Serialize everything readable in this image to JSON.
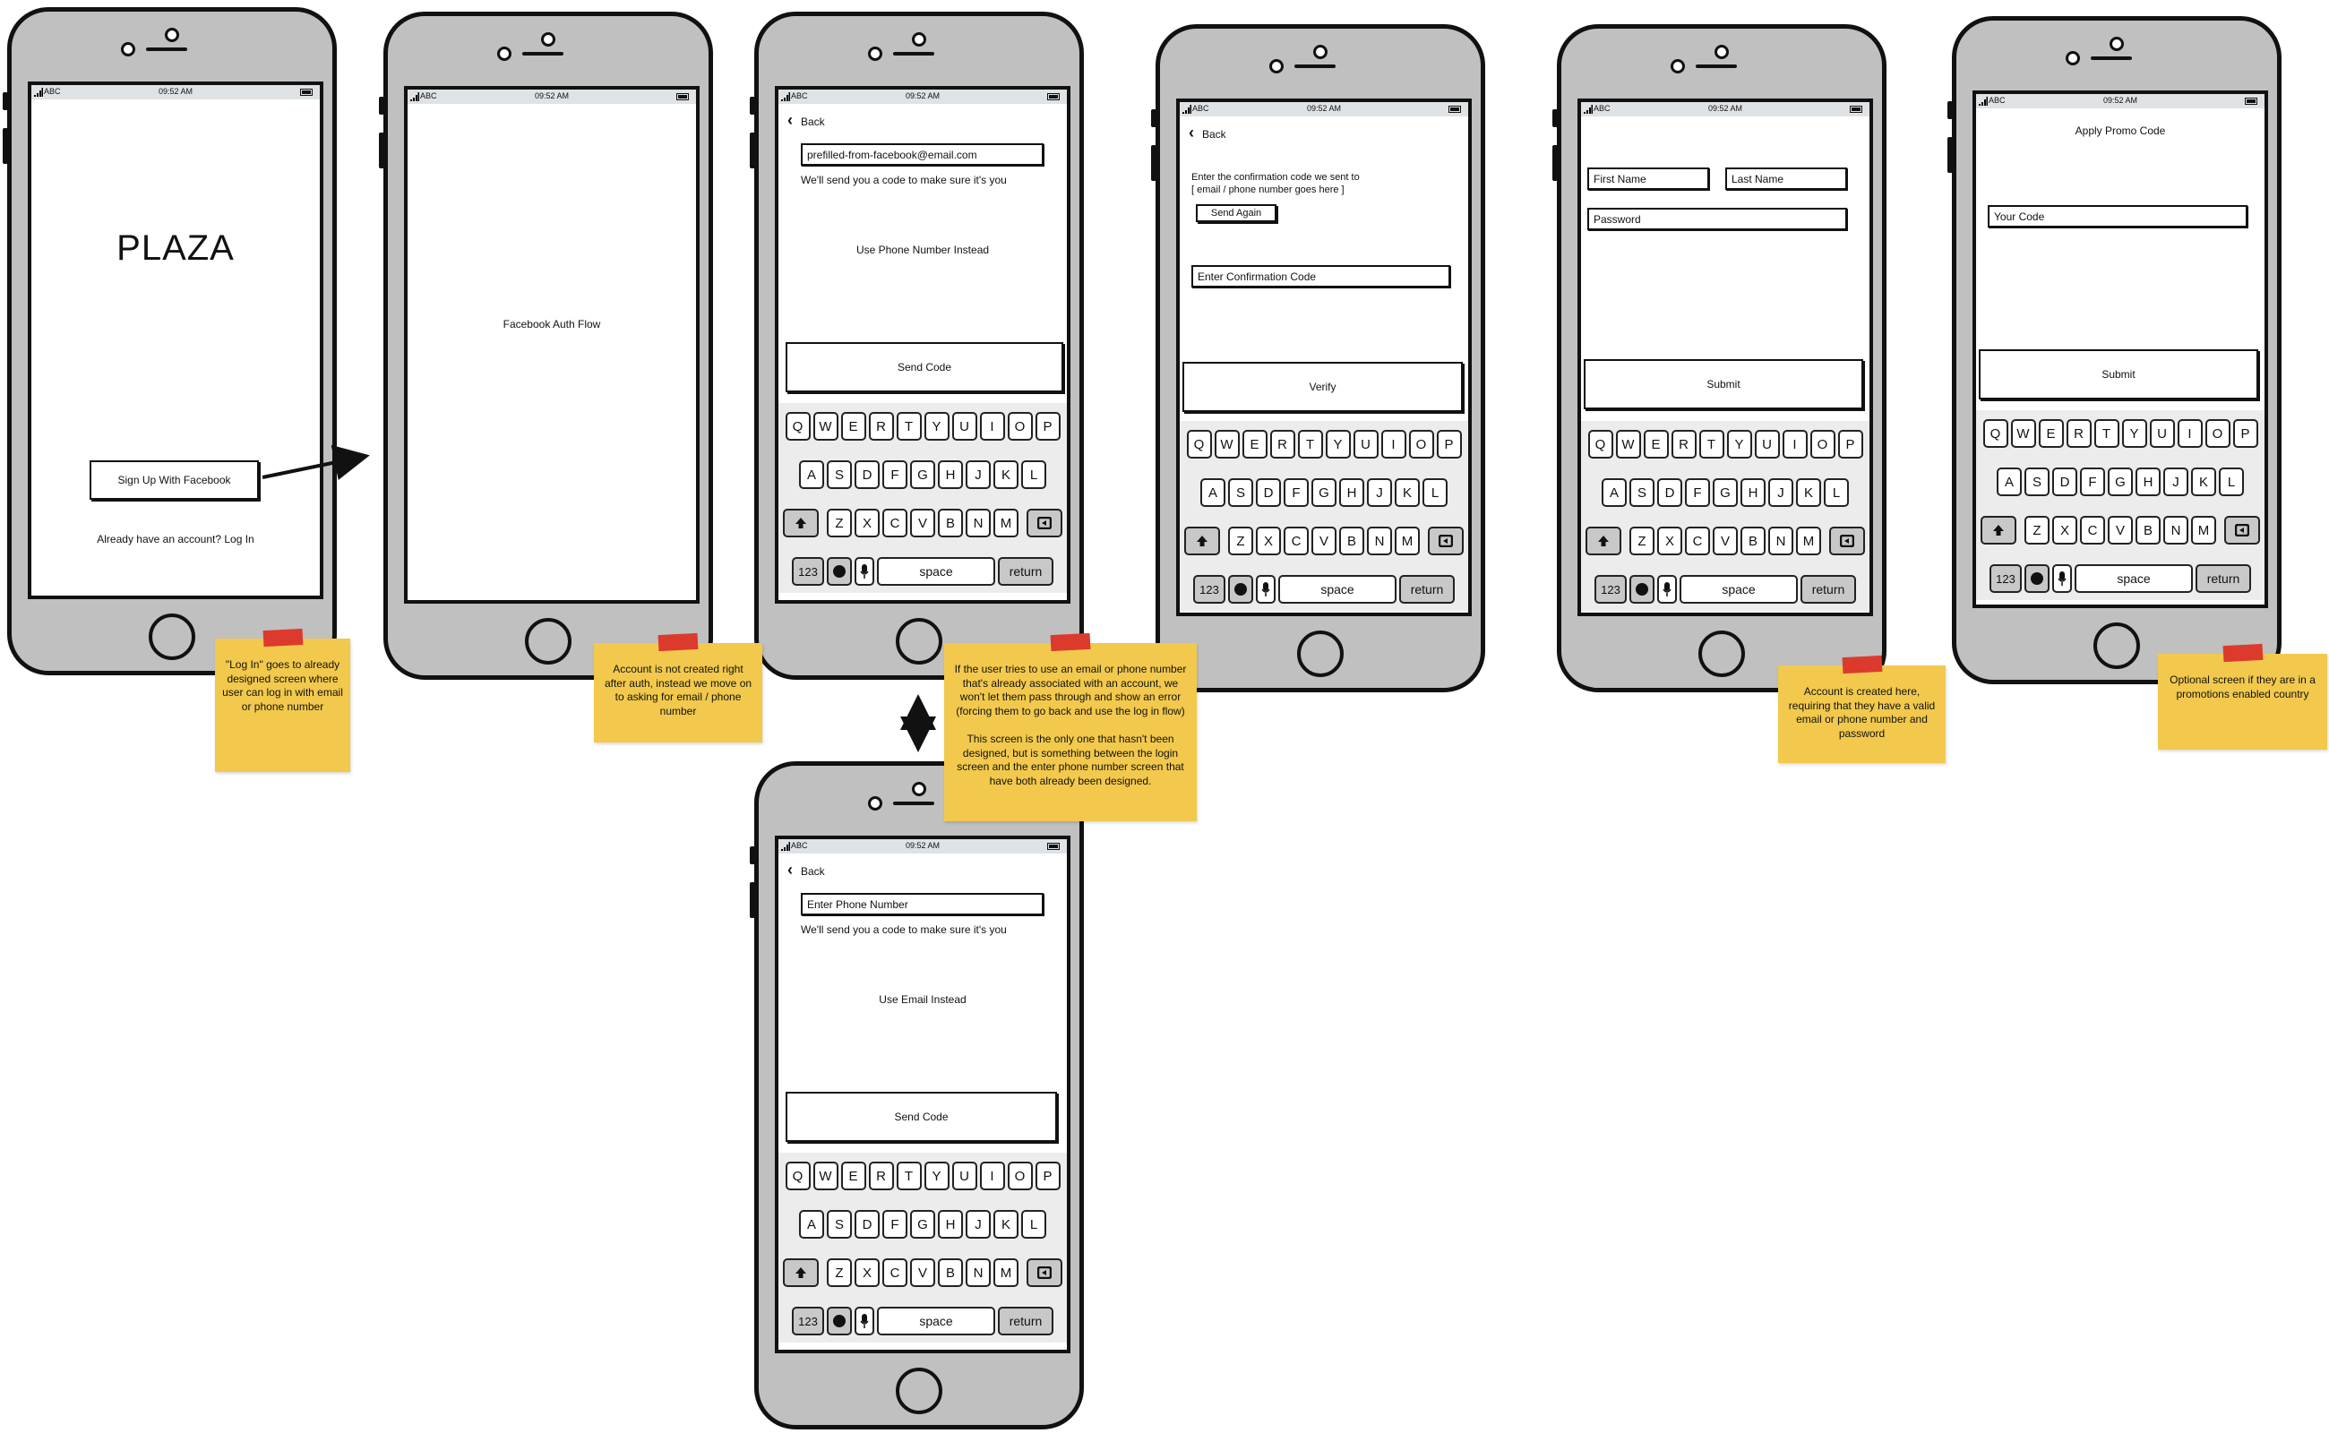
{
  "status_bar": {
    "carrier": "ABC",
    "time": "09:52 AM"
  },
  "phones": [
    {
      "logo": "PLAZA",
      "facebook_button": "Sign Up With Facebook",
      "login_link": "Already have an account? Log In"
    },
    {
      "label": "Facebook Auth Flow"
    },
    {
      "back": "Back",
      "input_value": "prefilled-from-facebook@email.com",
      "helper": "We'll send you a code to make sure it's you",
      "switch_link": "Use Phone Number Instead",
      "submit": "Send Code"
    },
    {
      "back": "Back",
      "input_placeholder": "Enter Phone Number",
      "helper": "We'll send you a code to make sure it's you",
      "switch_link": "Use Email Instead",
      "submit": "Send Code"
    },
    {
      "back": "Back",
      "instructions": [
        "Enter the confirmation code we sent to",
        "[ email / phone number goes here ]"
      ],
      "resend": "Send Again",
      "input_placeholder": "Enter Confirmation Code",
      "submit": "Verify"
    },
    {
      "first_name": "First Name",
      "last_name": "Last Name",
      "password": "Password",
      "submit": "Submit"
    },
    {
      "title": "Apply Promo Code",
      "input_placeholder": "Your Code",
      "submit": "Submit"
    }
  ],
  "keyboard": {
    "rows": [
      [
        "Q",
        "W",
        "E",
        "R",
        "T",
        "Y",
        "U",
        "I",
        "O",
        "P"
      ],
      [
        "A",
        "S",
        "D",
        "F",
        "G",
        "H",
        "J",
        "K",
        "L"
      ],
      [
        "Z",
        "X",
        "C",
        "V",
        "B",
        "N",
        "M"
      ]
    ],
    "numbers": "123",
    "space": "space",
    "return": "return",
    "icons": [
      "shift-icon",
      "delete-icon",
      "globe-icon",
      "microphone-icon"
    ]
  },
  "notes": [
    "\"Log In\" goes to already designed screen where user can log in with email or phone number",
    "Account is not created right after auth, instead we move on to asking for email / phone number",
    "If the user tries to use an email or phone number that's already associated with an account, we won't let them pass through and show an error (forcing them to go back and use the log in flow)\n\nThis screen is the only one that hasn't been designed, but is something between the login screen and the enter phone number screen that have both already been designed.",
    "Account is created here, requiring that they have a valid email or phone number and password",
    "Optional screen if they are in a promotions enabled country"
  ],
  "colors": {
    "phone_body": "#c0c0c0",
    "sticky_note": "#f2c94c",
    "tape": "#dd3a2e",
    "keyboard": "#ececec",
    "status_bar": "#dfe3e6"
  }
}
